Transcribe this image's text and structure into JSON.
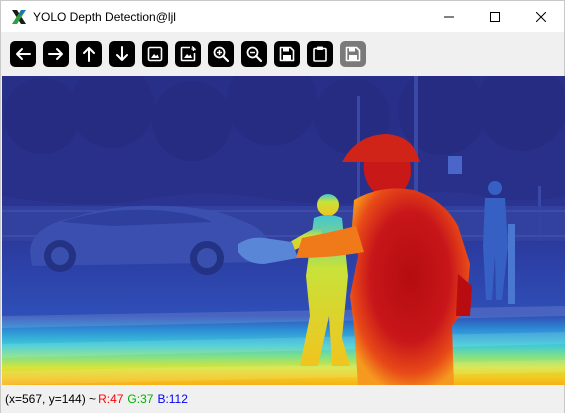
{
  "window": {
    "title": "YOLO Depth Detection@ljl",
    "app_icon": "x-logo-icon",
    "controls": [
      "minimize-icon",
      "maximize-icon",
      "close-icon"
    ]
  },
  "toolbar": {
    "buttons": [
      {
        "icon": "arrow-left-icon",
        "enabled": true
      },
      {
        "icon": "arrow-right-icon",
        "enabled": true
      },
      {
        "icon": "arrow-up-icon",
        "enabled": true
      },
      {
        "icon": "arrow-down-icon",
        "enabled": true
      },
      {
        "icon": "image-icon",
        "enabled": true
      },
      {
        "icon": "image-edit-icon",
        "enabled": true
      },
      {
        "icon": "zoom-in-icon",
        "enabled": true
      },
      {
        "icon": "zoom-out-icon",
        "enabled": true
      },
      {
        "icon": "save-icon",
        "enabled": true
      },
      {
        "icon": "clipboard-icon",
        "enabled": true
      },
      {
        "icon": "save-disabled-icon",
        "enabled": false
      }
    ]
  },
  "image": {
    "description_icon": "depth-map-image",
    "colors": {
      "far": "#2a3aa0",
      "mid": "#38c8e8",
      "near": "#f0d020",
      "closest": "#c81818"
    }
  },
  "status": {
    "coords": "(x=567, y=144) ~",
    "r": "R:47",
    "g": "G:37",
    "b": "B:112",
    "colors": {
      "r": "#ff0000",
      "g": "#00b000",
      "b": "#0000ff"
    }
  }
}
